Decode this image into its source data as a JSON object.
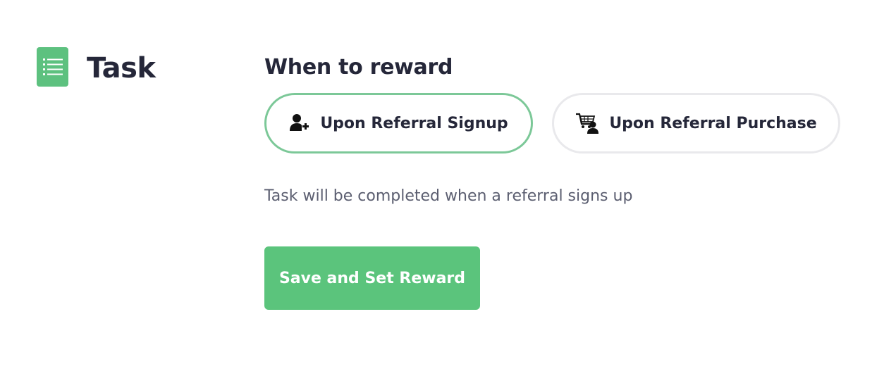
{
  "section": {
    "title": "Task",
    "icon": "list-icon"
  },
  "reward": {
    "heading": "When to reward",
    "options": [
      {
        "label": "Upon Referral Signup",
        "icon": "add-user-icon",
        "selected": true
      },
      {
        "label": "Upon Referral Purchase",
        "icon": "cart-user-icon",
        "selected": false
      }
    ],
    "description": "Task will be completed when a referral signs up",
    "save_label": "Save and Set Reward"
  },
  "colors": {
    "accent": "#5bc47c",
    "selected_border": "#7cc898",
    "unselected_border": "#e9e9ec",
    "text": "#252739",
    "muted_text": "#5b5e70"
  }
}
